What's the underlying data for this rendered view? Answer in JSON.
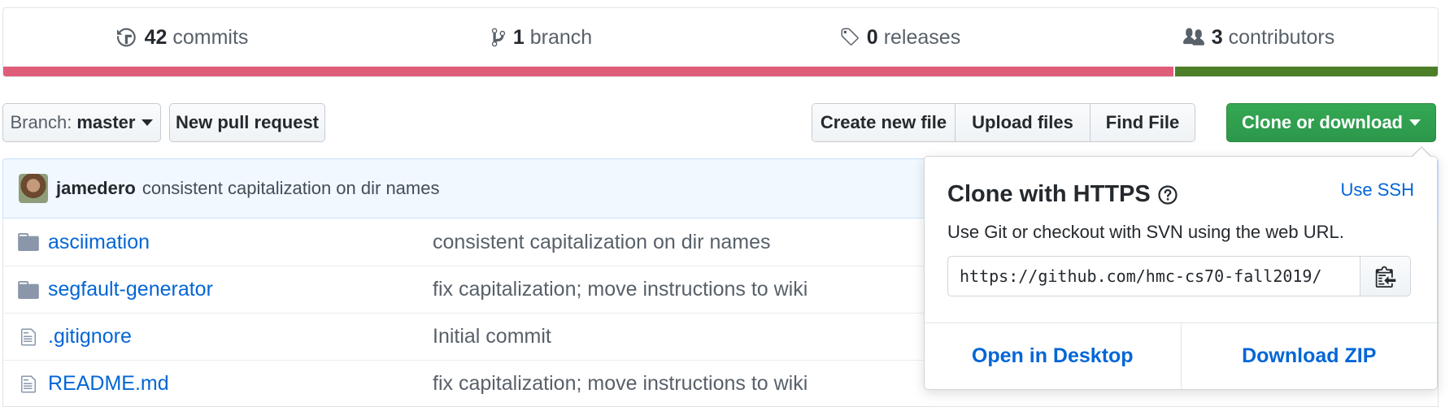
{
  "summary": {
    "commits": {
      "count": "42",
      "label": "commits",
      "icon": "history-icon"
    },
    "branches": {
      "count": "1",
      "label": "branch",
      "icon": "git-branch-icon"
    },
    "releases": {
      "count": "0",
      "label": "releases",
      "icon": "tag-icon"
    },
    "contributors": {
      "count": "3",
      "label": "contributors",
      "icon": "people-icon"
    }
  },
  "languages": [
    {
      "color": "#e05d7a",
      "percent": 81.6
    },
    {
      "color": "#4d7f28",
      "percent": 18.4
    }
  ],
  "toolbar": {
    "branch_label": "Branch:",
    "branch_value": "master",
    "new_pull_request": "New pull request",
    "create_new_file": "Create new file",
    "upload_files": "Upload files",
    "find_file": "Find File",
    "clone_or_download": "Clone or download"
  },
  "latest_commit": {
    "author": "jamedero",
    "message": "consistent capitalization on dir names"
  },
  "files": [
    {
      "name": "asciimation",
      "type": "directory",
      "message": "consistent capitalization on dir names"
    },
    {
      "name": "segfault-generator",
      "type": "directory",
      "message": "fix capitalization; move instructions to wiki"
    },
    {
      "name": ".gitignore",
      "type": "file",
      "message": "Initial commit"
    },
    {
      "name": "README.md",
      "type": "file",
      "message": "fix capitalization; move instructions to wiki"
    }
  ],
  "clone": {
    "title": "Clone with HTTPS",
    "use_ssh": "Use SSH",
    "description": "Use Git or checkout with SVN using the web URL.",
    "url": "https://github.com/hmc-cs70-fall2019/",
    "open_in_desktop": "Open in Desktop",
    "download_zip": "Download ZIP"
  },
  "colors": {
    "link": "#0366d6",
    "green_button": "#2c974b"
  }
}
